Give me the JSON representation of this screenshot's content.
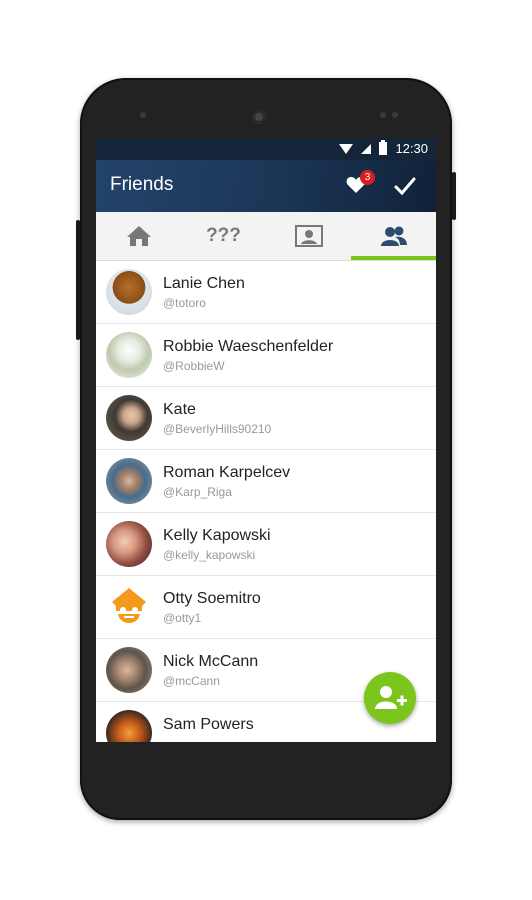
{
  "status_bar": {
    "time": "12:30"
  },
  "app_bar": {
    "title": "Friends",
    "notification_count": "3"
  },
  "tabs": [
    {
      "name": "home",
      "icon": "home-icon"
    },
    {
      "name": "mystery",
      "label": "???"
    },
    {
      "name": "profile",
      "icon": "contact-card-icon"
    },
    {
      "name": "friends",
      "icon": "people-icon",
      "active": true
    }
  ],
  "friends": [
    {
      "name": "Lanie Chen",
      "handle": "@totoro",
      "avatar_color": "#b5702a"
    },
    {
      "name": "Robbie Waeschenfelder",
      "handle": "@RobbieW",
      "avatar_color": "#d8e0c8"
    },
    {
      "name": "Kate",
      "handle": "@BeverlyHills90210",
      "avatar_color": "#6a5a4a"
    },
    {
      "name": "Roman Karpelcev",
      "handle": "@Karp_Riga",
      "avatar_color": "#5c7a92"
    },
    {
      "name": "Kelly Kapowski",
      "handle": "@kelly_kapowski",
      "avatar_color": "#c98a7a"
    },
    {
      "name": "Otty Soemitro",
      "handle": "@otty1",
      "avatar_color": "#f39a1a"
    },
    {
      "name": "Nick McCann",
      "handle": "@mcCann",
      "avatar_color": "#7a6d60"
    },
    {
      "name": "Sam Powers",
      "handle": "",
      "avatar_color": "#c45a18"
    }
  ],
  "colors": {
    "accent": "#7cc51d",
    "app_bar": "#1b3556",
    "badge": "#d71d1d"
  }
}
